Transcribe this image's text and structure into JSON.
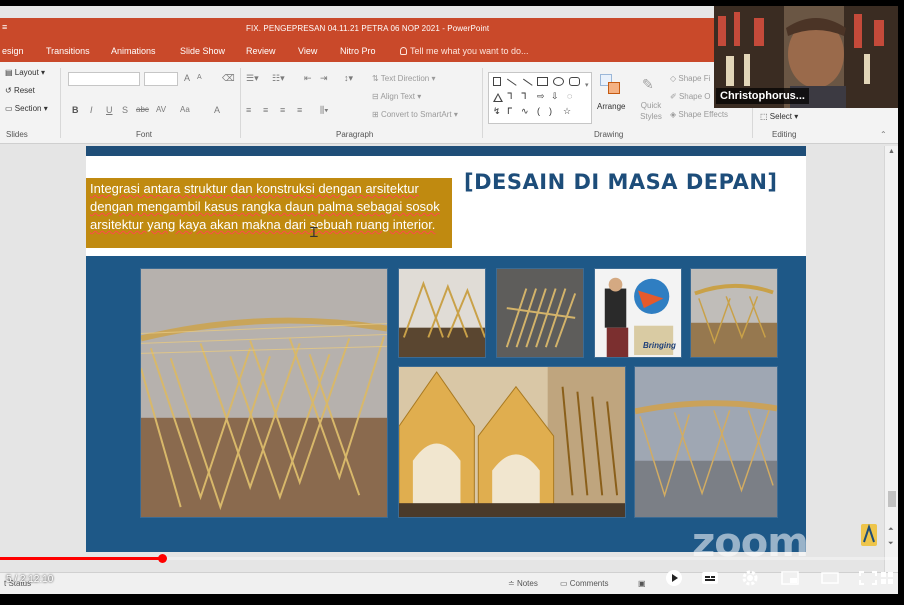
{
  "window": {
    "title": "FIX. PENGEPRESAN 04.11.21 PETRA 06 NOP 2021 - PowerPoint",
    "quick_access": "≡"
  },
  "ribbon_tabs": [
    "esign",
    "Transitions",
    "Animations",
    "Slide Show",
    "Review",
    "View",
    "Nitro Pro"
  ],
  "tell_me": "Tell me what you want to do...",
  "ribbon": {
    "slides": {
      "layout": "Layout",
      "reset": "Reset",
      "section": "Section",
      "label": "Slides"
    },
    "font": {
      "label": "Font",
      "bold": "B",
      "italic": "I",
      "underline": "U",
      "strike": "S",
      "abc": "abc",
      "av": "AV",
      "aa": "Aa",
      "font_color": "A",
      "grow": "A",
      "shrink": "A"
    },
    "paragraph": {
      "label": "Paragraph",
      "text_direction": "Text Direction",
      "align_text": "Align Text",
      "smartart": "Convert to SmartArt"
    },
    "drawing": {
      "label": "Drawing",
      "arrange": "Arrange",
      "quick_styles": "Quick Styles",
      "shape_fill": "Shape Fi",
      "shape_outline": "Shape O",
      "shape_effects": "Shape Effects"
    },
    "editing": {
      "label": "Editing",
      "select": "Select"
    }
  },
  "slide": {
    "heading": "[DESAIN DI MASA DEPAN]",
    "intro": "Integrasi antara struktur dan konstruksi dengan arsitektur dengan mengambil kasus rangka daun palma sebagai sosok arsitektur yang kaya akan makna dari sebuah ruang interior.",
    "poster_text": "Bringing"
  },
  "webcam": {
    "participant_name": "Christophorus..."
  },
  "statusbar": {
    "notes": "Notes",
    "comments": "Comments",
    "left_text": "t Status"
  },
  "video": {
    "time": "5 / 2:12:10",
    "progress_fraction": 0.18,
    "watermark": "zoom"
  },
  "colors": {
    "accent": "#c9492a",
    "slide_blue": "#1e5887",
    "heading_blue": "#1d4d7a",
    "intro_gold": "#c08a10",
    "progress_red": "#ff0000"
  }
}
